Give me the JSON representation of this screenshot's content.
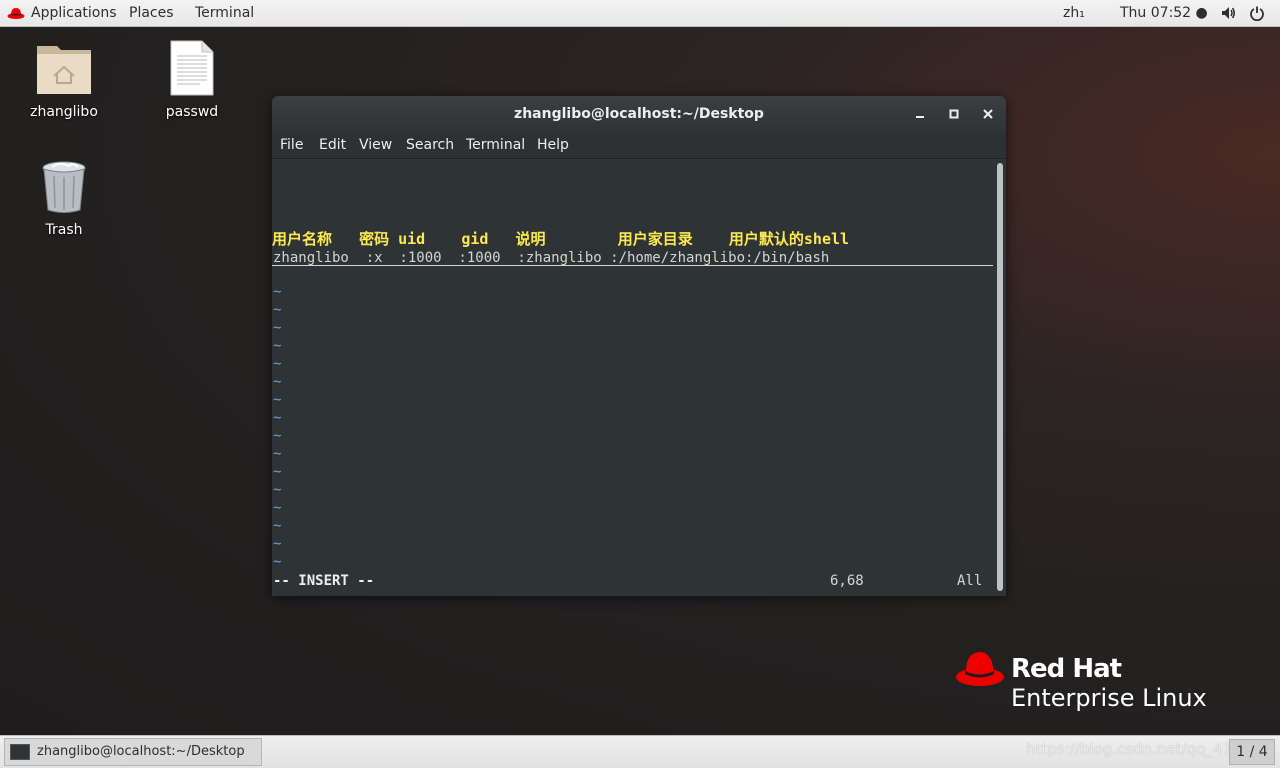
{
  "topbar": {
    "applications": "Applications",
    "places": "Places",
    "terminal": "Terminal",
    "lang": "zh₁",
    "clock": "Thu 07:52 ●",
    "icons": [
      "redhat-logo-icon",
      "volume-icon",
      "power-icon"
    ]
  },
  "desktop": {
    "home_folder": "zhanglibo",
    "file": "passwd",
    "trash": "Trash"
  },
  "window": {
    "title": "zhanglibo@localhost:~/Desktop",
    "menu": [
      "File",
      "Edit",
      "View",
      "Search",
      "Terminal",
      "Help"
    ]
  },
  "vim": {
    "header": "用户名称   密码 uid    gid   说明        用户家目录    用户默认的shell",
    "line": "zhanglibo  :x  :1000  :1000  :zhanglibo :/home/zhanglibo:/bin/bash",
    "tilde": "~",
    "mode": "-- INSERT --",
    "position": "6,68",
    "scroll": "All"
  },
  "brand": {
    "line1": "Red Hat",
    "line2": "Enterprise Linux",
    "color": "#ee0000"
  },
  "taskbar": {
    "task_label": "zhanglibo@localhost:~/Desktop",
    "watermark": "https://blog.csdn.net/qq_4163",
    "workspace": "1 / 4"
  }
}
